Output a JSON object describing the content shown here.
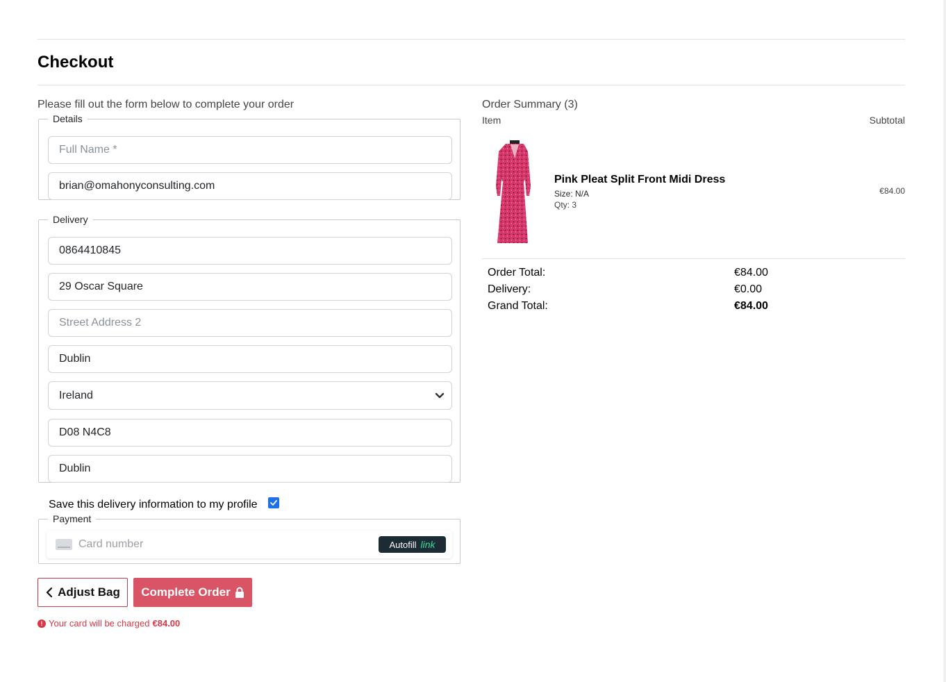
{
  "page": {
    "title": "Checkout",
    "instructions": "Please fill out the form below to complete your order"
  },
  "details": {
    "legend": "Details",
    "full_name": {
      "value": "",
      "placeholder": "Full Name *"
    },
    "email": {
      "value": "brian@omahonyconsulting.com",
      "placeholder": ""
    }
  },
  "delivery": {
    "legend": "Delivery",
    "phone": "0864410845",
    "street1": "29 Oscar Square",
    "street2": {
      "value": "",
      "placeholder": "Street Address 2"
    },
    "town": "Dublin",
    "country": "Ireland",
    "postcode": "D08 N4C8",
    "county": "Dublin"
  },
  "save_info": {
    "label": "Save this delivery information to my profile",
    "checked": true
  },
  "payment": {
    "legend": "Payment",
    "card_placeholder": "Card number",
    "autofill_label": "Autofill",
    "autofill_brand": "link"
  },
  "buttons": {
    "adjust_bag": "Adjust Bag",
    "complete_order": "Complete Order"
  },
  "charge_notice": {
    "text": "Your card will be charged",
    "amount": "€84.00"
  },
  "summary": {
    "title": "Order Summary (3)",
    "col_item": "Item",
    "col_subtotal": "Subtotal",
    "items": [
      {
        "name": "Pink Pleat Split Front Midi Dress",
        "size": "Size: N/A",
        "qty": "Qty: 3",
        "subtotal": "€84.00"
      }
    ],
    "totals": {
      "order_total_label": "Order Total:",
      "order_total": "€84.00",
      "delivery_label": "Delivery:",
      "delivery": "€0.00",
      "grand_total_label": "Grand Total:",
      "grand_total": "€84.00"
    }
  },
  "colors": {
    "primary_button": "#d95565",
    "outline_button_border": "#c43a4a",
    "error_text": "#dc3545",
    "checkbox": "#1f6feb",
    "link_badge_bg": "#1d2b35",
    "link_brand": "#33dd99"
  }
}
